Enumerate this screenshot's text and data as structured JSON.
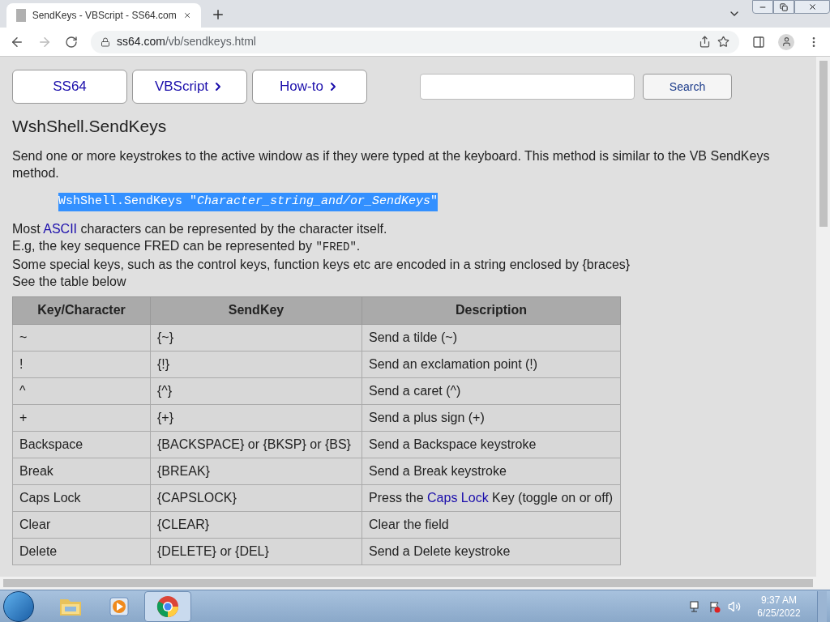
{
  "browser": {
    "tab_title": "SendKeys - VBScript - SS64.com",
    "url_host": "ss64.com",
    "url_path": "/vb/sendkeys.html"
  },
  "nav": [
    {
      "label": "SS64",
      "arrow": false
    },
    {
      "label": "VBScript",
      "arrow": true
    },
    {
      "label": "How-to",
      "arrow": true
    }
  ],
  "search": {
    "button": "Search"
  },
  "heading": "WshShell.SendKeys",
  "intro": "Send one or more keystrokes to the active window as if they were typed at the keyboard. This method is similar to the VB SendKeys method.",
  "syntax": {
    "text": "WshShell.SendKeys \"*Character_string_and/or_SendKeys*\"",
    "selected": true
  },
  "notes": [
    {
      "before": "Most ",
      "link": "ASCII",
      "after": " characters can be represented by the character itself."
    },
    {
      "before": "E.g, the key sequence FRED can be represented by ",
      "code": "\"FRED\"",
      "after": "."
    },
    {
      "before": "Some special keys, such as the control keys, function keys etc are encoded in a string enclosed by {braces}"
    },
    {
      "before": "See the table below"
    }
  ],
  "table": {
    "columns": [
      "Key/Character",
      "SendKey",
      "Description"
    ],
    "rows": [
      {
        "key": "~",
        "sendkey": "{~}",
        "description": {
          "before": "Send a tilde (~)"
        }
      },
      {
        "key": "!",
        "sendkey": "{!}",
        "description": {
          "before": "Send an exclamation point (!)"
        }
      },
      {
        "key": "^",
        "sendkey": "{^}",
        "description": {
          "before": "Send a caret (^)"
        }
      },
      {
        "key": "+",
        "sendkey": "{+}",
        "description": {
          "before": "Send a plus sign (+)"
        }
      },
      {
        "key": "Backspace",
        "sendkey": "{BACKSPACE} or {BKSP} or {BS}",
        "description": {
          "before": "Send a Backspace keystroke"
        }
      },
      {
        "key": "Break",
        "sendkey": "{BREAK}",
        "description": {
          "before": "Send a Break keystroke"
        }
      },
      {
        "key": "Caps Lock",
        "sendkey": "{CAPSLOCK}",
        "description": {
          "before": "Press the ",
          "link": "Caps Lock",
          "after": " Key (toggle on or off)"
        }
      },
      {
        "key": "Clear",
        "sendkey": "{CLEAR}",
        "description": {
          "before": "Clear the field"
        }
      },
      {
        "key": "Delete",
        "sendkey": "{DELETE} or {DEL}",
        "description": {
          "before": "Send a Delete keystroke"
        }
      }
    ]
  },
  "taskbar": {
    "apps": [
      {
        "kind": "folder",
        "selected": false
      },
      {
        "kind": "player",
        "selected": false
      },
      {
        "kind": "chrome",
        "selected": true
      }
    ],
    "time": "9:37 AM",
    "date": "6/25/2022"
  }
}
